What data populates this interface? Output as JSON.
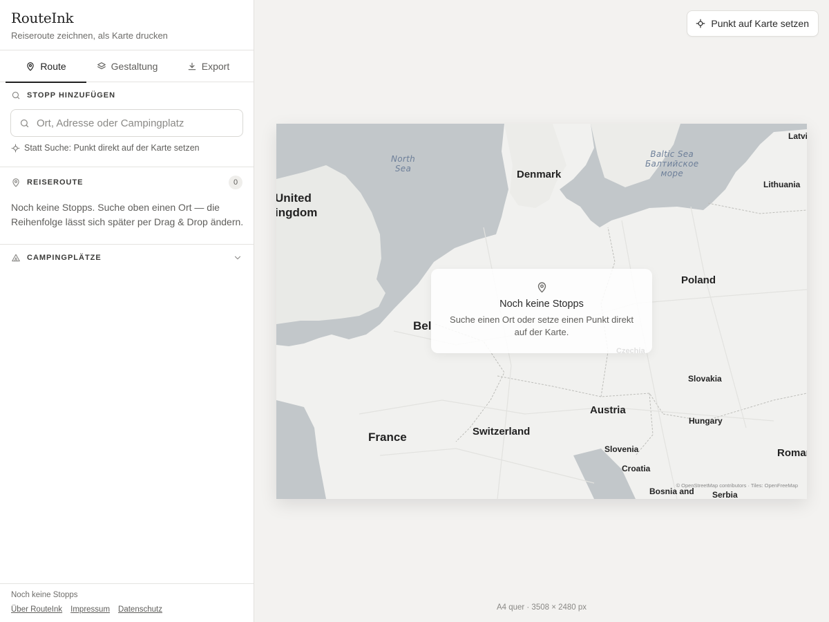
{
  "app": {
    "name": "RouteInk",
    "tagline": "Reiseroute zeichnen, als Karte drucken"
  },
  "tabs": [
    {
      "label": "Route",
      "icon": "map-pin-icon",
      "active": true
    },
    {
      "label": "Gestaltung",
      "icon": "layers-icon",
      "active": false
    },
    {
      "label": "Export",
      "icon": "download-icon",
      "active": false
    }
  ],
  "add_stop": {
    "heading": "STOPP HINZUFÜGEN",
    "placeholder": "Ort, Adresse oder Campingplatz",
    "value": "",
    "map_hint": "Statt Suche: Punkt direkt auf der Karte setzen"
  },
  "itinerary": {
    "heading": "REISEROUTE",
    "count": "0",
    "empty_text": "Noch keine Stopps. Suche oben einen Ort — die Reihenfolge lässt sich später per Drag & Drop ändern."
  },
  "campsites": {
    "heading": "CAMPINGPLÄTZE",
    "expanded": false
  },
  "footer": {
    "status": "Noch keine Stopps",
    "links": [
      "Über RouteInk",
      "Impressum",
      "Datenschutz"
    ]
  },
  "toolbar": {
    "place_point_label": "Punkt auf Karte setzen"
  },
  "map": {
    "countries": [
      "Latvi",
      "Denmark",
      "Lithuania",
      "United",
      "ingdom",
      "Poland",
      "Bel",
      "Slovakia",
      "France",
      "Austria",
      "Hungary",
      "Switzerland",
      "Slovenia",
      "Croatia",
      "Roman",
      "Bosnia and",
      "Serbia",
      "Czechia"
    ],
    "seas": {
      "north_sea": "North\nSea",
      "baltic_sea": "Baltic Sea\nБалтийское\nморе"
    },
    "attribution": "© OpenStreetMap contributors · Tiles: OpenFreeMap",
    "empty_state": {
      "title": "Noch keine Stopps",
      "text": "Suche einen Ort oder setze einen Punkt direkt auf der Karte."
    }
  },
  "format_label": "A4 quer · 3508 × 2480 px",
  "colors": {
    "accent": "#1f1f1f",
    "water": "#c2c7ca",
    "land": "#f1f1ef",
    "background": "#f3f2f0"
  }
}
